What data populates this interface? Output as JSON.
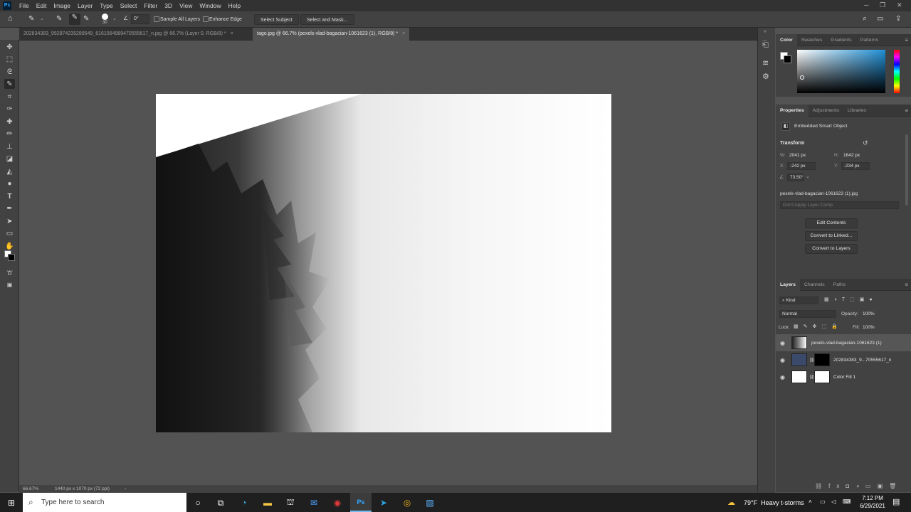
{
  "app": {
    "logo_text": "Ps",
    "menu": [
      "File",
      "Edit",
      "Image",
      "Layer",
      "Type",
      "Select",
      "Filter",
      "3D",
      "View",
      "Window",
      "Help"
    ]
  },
  "options_bar": {
    "brush_size": "30",
    "angle": "0°",
    "sample_all_layers": "Sample All Layers",
    "enhance_edge": "Enhance Edge",
    "select_subject": "Select Subject",
    "select_and_mask": "Select and Mask..."
  },
  "tabs": [
    {
      "label": "202834383_952874235289549_6161564989470555617_n.jpg @ 66.7% (Layer 0, RGB/8) *",
      "active": false
    },
    {
      "label": "tago.jpg @ 66.7% (pexels-vlad-bagacian-1061623 (1), RGB/8) *",
      "active": true
    }
  ],
  "status": {
    "zoom": "66.67%",
    "doc_info": "1440 px x 1070 px (72 ppi)"
  },
  "color_panel": {
    "tabs": [
      "Color",
      "Swatches",
      "Gradients",
      "Patterns"
    ]
  },
  "properties_panel": {
    "tabs": [
      "Properties",
      "Adjustments",
      "Libraries"
    ],
    "type_label": "Embedded Smart Object",
    "transform_title": "Transform",
    "w_label": "W:",
    "w_value": "2041 px",
    "h_label": "H:",
    "h_value": "1642 px",
    "x_label": "X:",
    "x_value": "-242 px",
    "y_label": "Y:",
    "y_value": "-234 px",
    "angle_value": "73.50°",
    "filename": "pexels-vlad-bagacian-1061623 (1).jpg",
    "layer_comp_placeholder": "Don't Apply Layer Comp",
    "btn_edit": "Edit Contents",
    "btn_convert_linked": "Convert to Linked...",
    "btn_convert_layers": "Convert to Layers"
  },
  "layers_panel": {
    "tabs": [
      "Layers",
      "Channels",
      "Paths"
    ],
    "kind": "Kind",
    "blend_mode": "Normal",
    "opacity_label": "Opacity:",
    "opacity_value": "100%",
    "lock_label": "Lock:",
    "fill_label": "Fill:",
    "fill_value": "100%",
    "layers": [
      {
        "name": "pexels-vlad-bagacian-1061623 (1)",
        "selected": true
      },
      {
        "name": "202834383_9...70555617_n",
        "selected": false
      },
      {
        "name": "Color Fill 1",
        "selected": false
      }
    ]
  },
  "taskbar": {
    "search_placeholder": "Type here to search",
    "weather": "79°F  Heavy t-storms",
    "time": "7:12 PM",
    "date": "6/29/2021"
  }
}
